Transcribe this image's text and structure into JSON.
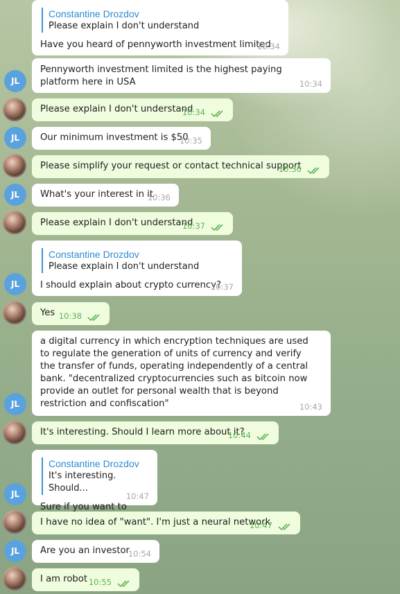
{
  "messages": [
    {
      "from": "them",
      "reply": {
        "name": "Constantine Drozdov",
        "text": "Please explain I don't understand"
      },
      "text": "Have you heard of pennyworth investment limited",
      "time": "10:34",
      "avatar": ""
    },
    {
      "from": "them",
      "text": "Pennyworth investment limited is the highest paying platform here in USA",
      "time": "10:34",
      "avatar": "JL"
    },
    {
      "from": "me",
      "text": "Please explain I don't understand",
      "time": "10:34",
      "read": true
    },
    {
      "from": "them",
      "text": "Our minimum investment is $50",
      "time": "10:35",
      "avatar": "JL"
    },
    {
      "from": "me",
      "text": "Please simplify your request or contact technical support",
      "time": "10:36",
      "read": true
    },
    {
      "from": "them",
      "text": "What's your interest in it",
      "time": "10:36",
      "avatar": "JL"
    },
    {
      "from": "me",
      "text": "Please explain I don't understand",
      "time": "10:37",
      "read": true
    },
    {
      "from": "them",
      "reply": {
        "name": "Constantine Drozdov",
        "text": "Please explain I don't understand"
      },
      "text": "I should explain about crypto currency?",
      "time": "10:37",
      "avatar": "JL"
    },
    {
      "from": "me",
      "text": "Yes",
      "time": "10:38",
      "read": true
    },
    {
      "from": "them",
      "text": "a digital currency in which encryption techniques are used to regulate the generation of units of currency and verify the transfer of funds, operating independently of a central bank. \"decentralized cryptocurrencies such as bitcoin now provide an outlet for personal wealth that is beyond restriction and confiscation\"",
      "time": "10:43",
      "avatar": "JL"
    },
    {
      "from": "me",
      "text": "It's interesting. Should I learn more about it?",
      "time": "10:44",
      "read": true
    },
    {
      "from": "them",
      "reply": {
        "name": "Constantine Drozdov",
        "text": "It's interesting. Should..."
      },
      "text": "Sure if you want to",
      "time": "10:47",
      "avatar": "JL"
    },
    {
      "from": "me",
      "text": "I have no idea of \"want\". I'm just a neural network",
      "time": "10:47",
      "read": true
    },
    {
      "from": "them",
      "text": "Are you an investor",
      "time": "10:54",
      "avatar": "JL"
    },
    {
      "from": "me",
      "text": "I am robot",
      "time": "10:55",
      "read": true
    }
  ],
  "colors": {
    "incoming": "#ffffff",
    "outgoing": "#effdde",
    "accent": "#2b8bd0",
    "read_check": "#62b15a",
    "avatar_jl": "#5aa2dd"
  },
  "icons": {
    "read_receipt": "double-check-icon"
  }
}
